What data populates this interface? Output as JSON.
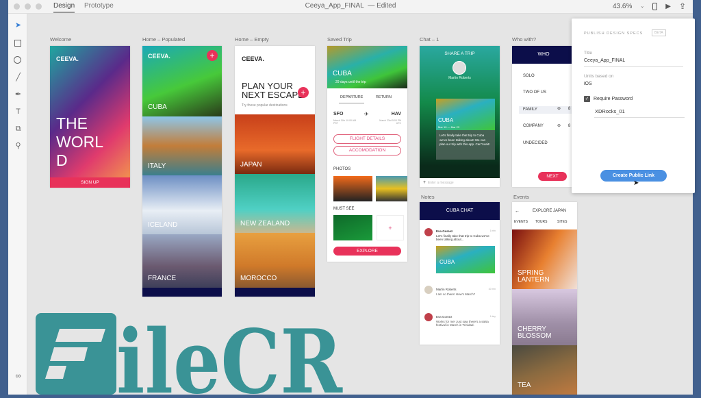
{
  "topbar": {
    "tabs": [
      "Design",
      "Prototype"
    ],
    "document_title": "Ceeya_App_FINAL",
    "status": "— Edited",
    "zoom": "43.6%"
  },
  "tools": [
    "select-icon",
    "rectangle-icon",
    "ellipse-icon",
    "line-icon",
    "pen-icon",
    "text-icon",
    "artboard-icon",
    "zoom-icon",
    "assets-icon"
  ],
  "artboards": {
    "welcome": {
      "label": "Welcome",
      "brand": "CEEVA.",
      "headline": "THE WORL D",
      "button": "SIGN UP"
    },
    "home_populated": {
      "label": "Home – Populated",
      "brand": "CEEVA.",
      "places": [
        "CUBA",
        "ITALY",
        "ICELAND",
        "FRANCE"
      ]
    },
    "home_empty": {
      "label": "Home – Empty",
      "brand": "CEEVA.",
      "headline": "PLAN YOUR NEXT ESCAPE",
      "sub": "Try these popular destinations",
      "places": [
        "JAPAN",
        "NEW ZEALAND",
        "MOROCCO"
      ]
    },
    "saved_trip": {
      "label": "Saved Trip",
      "dest": "CUBA",
      "countdown": "29 days until the trip",
      "tabs": [
        "DEPARTURE",
        "RETURN"
      ],
      "from": "SFO",
      "to": "HAV",
      "from_time": "March 11th 10:00 AM PST",
      "to_time": "March 23rd 5:00 PM UTC",
      "buttons": [
        "FLIGHT DETAILS",
        "ACCOMODATION"
      ],
      "photos": "PHOTOS",
      "must_see": "MUST SEE",
      "explore": "EXPLORE"
    },
    "chat1": {
      "label": "Chat – 1",
      "title": "SHARE A TRIP",
      "person": "Martin Roberts",
      "card": "CUBA",
      "card_dates": "Mar 10 — Mar 23",
      "message": "Let's finally take that trip to Cuba we've been talking about! We can plan our trip with this app. Can't wait!",
      "input_placeholder": "Enter a message"
    },
    "who": {
      "label": "Who with?",
      "title": "WHO",
      "options": [
        "SOLO",
        "TWO OF US",
        "FAMILY",
        "COMPANY",
        "UNDECIDED"
      ],
      "count": "8",
      "next": "NEXT"
    },
    "notes": {
      "label": "Notes",
      "title": "CUBA CHAT",
      "messages": [
        {
          "name": "Eva Gomez",
          "time": "1 min",
          "text": "Let's finally take that trip to Cuba we've been talking about..."
        },
        {
          "name": "Martin Roberts",
          "time": "10 min",
          "text": "I am so there! How's March?"
        },
        {
          "name": "Eva Gomez",
          "time": "1 day",
          "text": "Works for me! Just saw there's a salsa festival in March in Trinidad."
        }
      ],
      "card": "CUBA"
    },
    "events": {
      "label": "Events",
      "title": "EXPLORE JAPAN",
      "tabs": [
        "EVENTS",
        "TOURS",
        "SITES"
      ],
      "items": [
        "SPRING LANTERN",
        "CHERRY BLOSSOM",
        "TEA"
      ]
    }
  },
  "publish": {
    "heading": "PUBLISH DESIGN SPECS",
    "badge": "BETA",
    "title_label": "Title",
    "title_value": "Ceeya_App_FINAL",
    "units_label": "Units based on",
    "units_value": "iOS",
    "require_password": "Require Password",
    "require_password_checked": true,
    "password": "XDRocks_01",
    "create_button": "Create Public Link"
  },
  "watermark": "FileCR",
  "colors": {
    "accent": "#e8325a",
    "navy": "#0c0e4a",
    "button_blue": "#4a90e2",
    "watermark": "#3a9396"
  }
}
